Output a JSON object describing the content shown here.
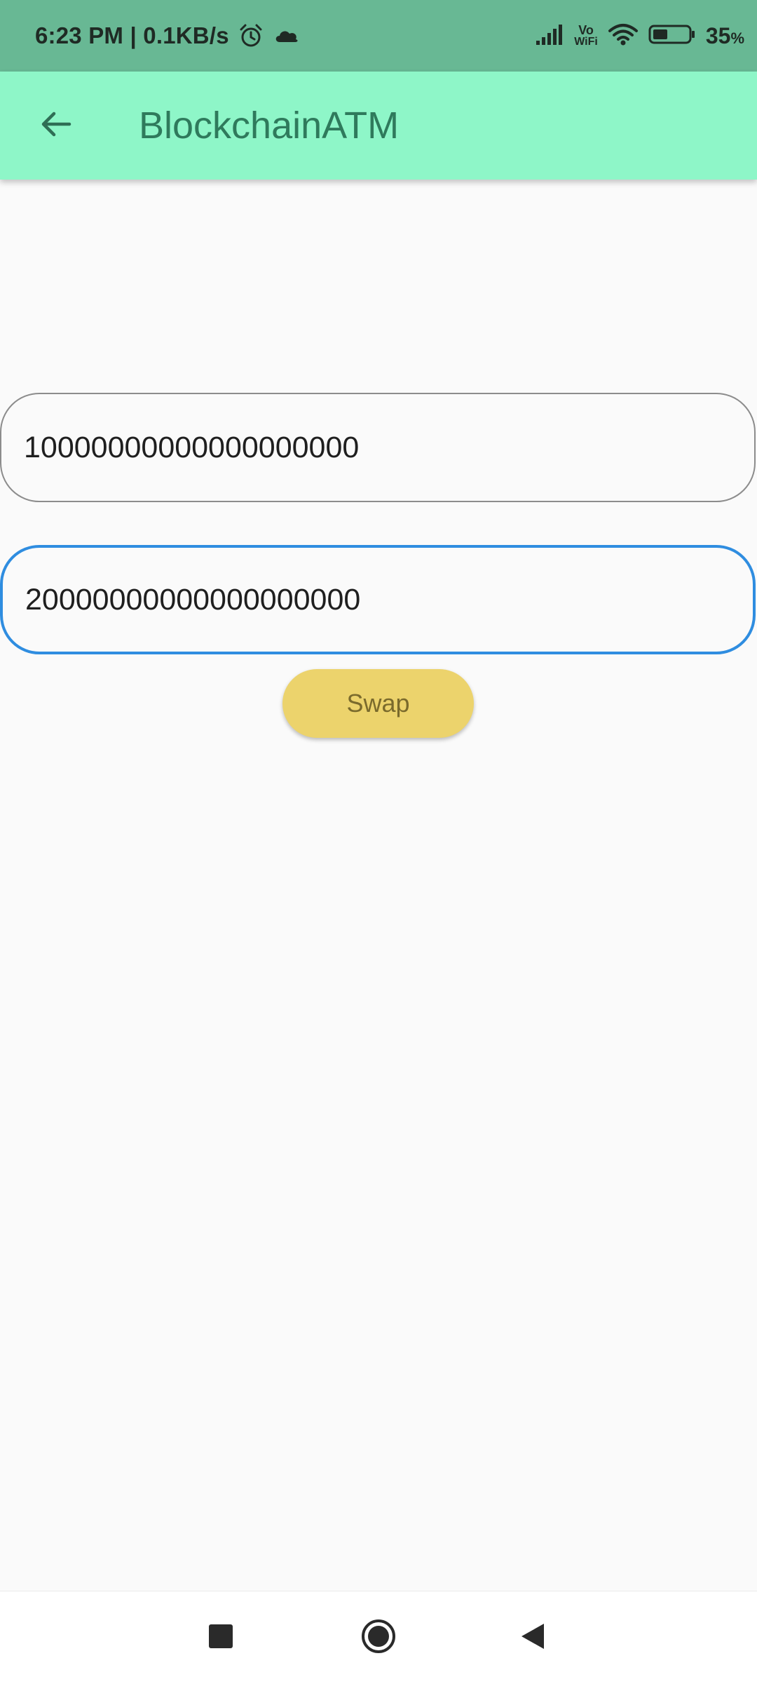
{
  "status_bar": {
    "time_and_speed": "6:23 PM | 0.1KB/s",
    "battery_percent": "35",
    "battery_unit": "%",
    "vowifi_top": "Vo",
    "vowifi_bottom": "WiFi",
    "icons": [
      "alarm-icon",
      "cloud-icon",
      "signal-icon",
      "vowifi-icon",
      "wifi-icon",
      "battery-icon"
    ]
  },
  "app_bar": {
    "title": "BlockchainATM",
    "back_icon": "arrow-left-icon"
  },
  "form": {
    "field_1_value": "10000000000000000000",
    "field_2_value": "20000000000000000000",
    "swap_label": "Swap"
  },
  "nav_bar": {
    "icons": [
      "recents-icon",
      "home-icon",
      "back-icon"
    ]
  },
  "colors": {
    "status_bar": "#68b894",
    "app_bar": "#8ef6c8",
    "title": "#2f7a5c",
    "focused_border": "#2f8de0",
    "swap_button": "#ecd36c"
  }
}
